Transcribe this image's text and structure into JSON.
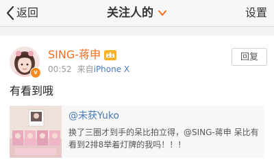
{
  "nav": {
    "back_label": "返回",
    "title": "关注人的"
  },
  "header_actions": {
    "settings_label": "设置"
  },
  "post": {
    "author": "SING-蒋申",
    "time": "00:52",
    "source_prefix": "来自",
    "source_device": "iPhone X",
    "reply_label": "回复",
    "text": "有看到哦",
    "badge_glyph": "v"
  },
  "quote": {
    "author": "@未获Yuko",
    "text": "换了三圈才到手的呆比拍立得，@SING-蒋申 呆比有看到2排8举着灯牌的我吗！！！"
  },
  "colors": {
    "brand_orange": "#f76b1c",
    "link_blue": "#4a7ab8"
  },
  "icons": [
    "back-chevron-icon",
    "dropdown-chevron-icon",
    "verified-badge-icon",
    "member-crown-icon"
  ]
}
